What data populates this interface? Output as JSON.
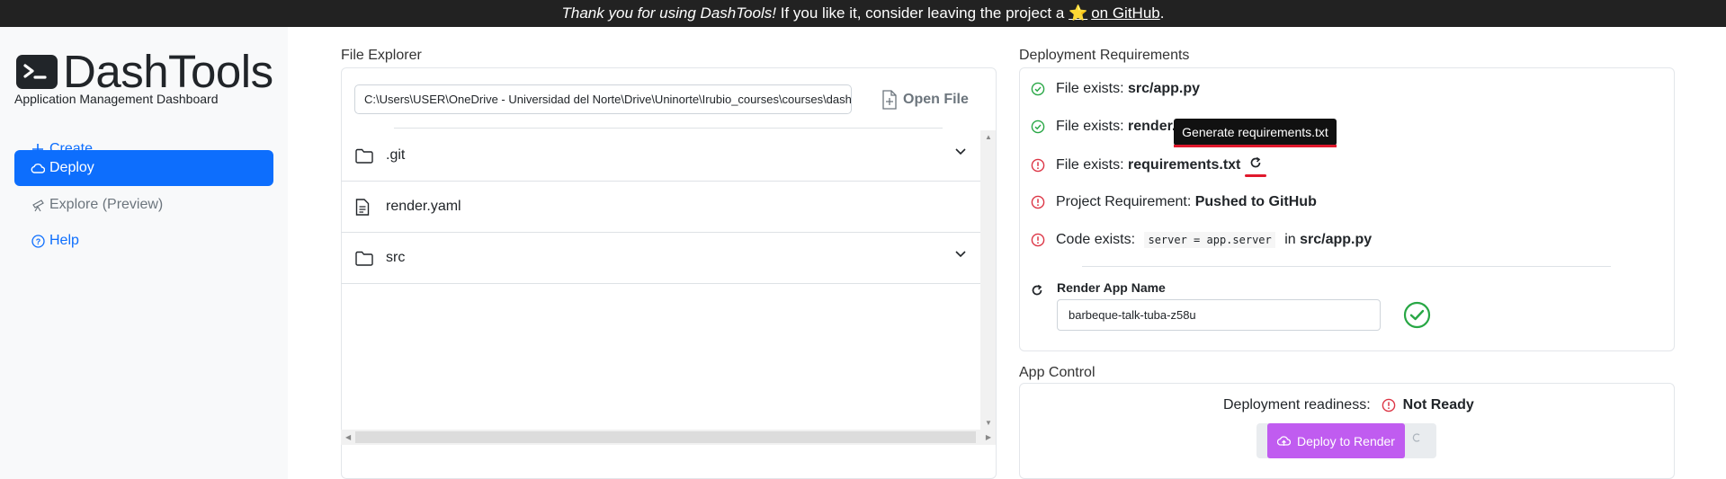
{
  "banner": {
    "thanks": "Thank you for using DashTools!",
    "message": " If you like it, consider leaving the project a ",
    "star": "⭐",
    "link_text": "on GitHub",
    "end": "."
  },
  "sidebar": {
    "logo_text": "DashTools",
    "subtitle": "Application Management Dashboard",
    "items": [
      {
        "label": "Create",
        "icon": "plus-icon",
        "state": "link"
      },
      {
        "label": "Deploy",
        "icon": "cloud-icon",
        "state": "active"
      },
      {
        "label": "Explore (Preview)",
        "icon": "telescope-icon",
        "state": "muted"
      },
      {
        "label": "Help",
        "icon": "question-circle-icon",
        "state": "link"
      }
    ]
  },
  "file_explorer": {
    "title": "File Explorer",
    "path_value": "C:\\Users\\USER\\OneDrive - Universidad del Norte\\Drive\\Uninorte\\Irubio_courses\\courses\\dash",
    "open_file_label": "Open File",
    "entries": [
      {
        "name": ".git",
        "type": "folder",
        "expandable": true
      },
      {
        "name": "render.yaml",
        "type": "file",
        "expandable": false
      },
      {
        "name": "src",
        "type": "folder",
        "expandable": true
      }
    ]
  },
  "deployment_requirements": {
    "title": "Deployment Requirements",
    "rows": [
      {
        "status": "ok",
        "prefix": "File exists: ",
        "bold": "src/app.py"
      },
      {
        "status": "ok",
        "prefix": "File exists: ",
        "bold": "render.y"
      },
      {
        "status": "error",
        "prefix": "File exists: ",
        "bold": "requirements.txt"
      },
      {
        "status": "error",
        "prefix": "Project Requirement: ",
        "bold": "Pushed to GitHub"
      },
      {
        "status": "error",
        "prefix": "Code exists: ",
        "code": "server = app.server",
        "middle": " in ",
        "bold": "src/app.py"
      }
    ],
    "tooltip": "Generate requirements.txt",
    "app_name_label": "Render App Name",
    "app_name_value": "barbeque-talk-tuba-z58u",
    "colors": {
      "ok": "#28a745",
      "error": "#dc3545"
    }
  },
  "app_control": {
    "title": "App Control",
    "readiness_label": "Deployment readiness:",
    "readiness_value": "Not Ready",
    "deploy_label": "Deploy to Render",
    "deploy_color": "#c05cf0"
  }
}
